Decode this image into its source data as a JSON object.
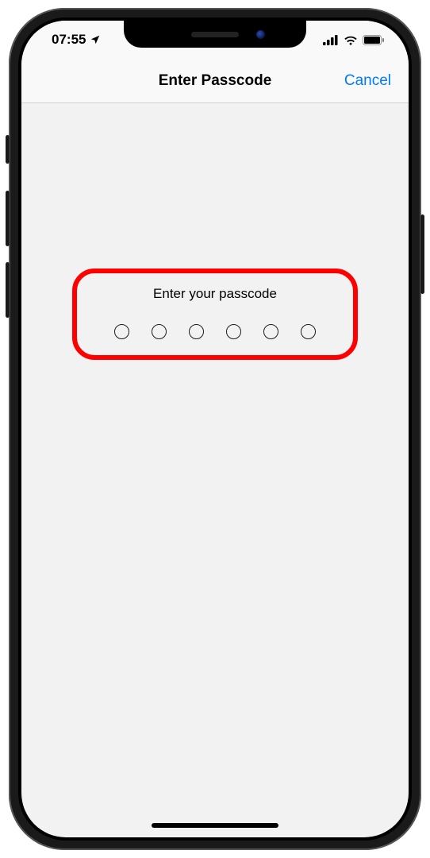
{
  "status": {
    "time": "07:55",
    "location_icon": "location-arrow",
    "signal_icon": "cellular-signal",
    "wifi_icon": "wifi",
    "battery_icon": "battery-full"
  },
  "nav": {
    "title": "Enter Passcode",
    "cancel_label": "Cancel"
  },
  "passcode": {
    "prompt": "Enter your passcode",
    "digit_count": 6,
    "filled_count": 0
  },
  "annotation": {
    "highlight_color": "#ff0000"
  }
}
